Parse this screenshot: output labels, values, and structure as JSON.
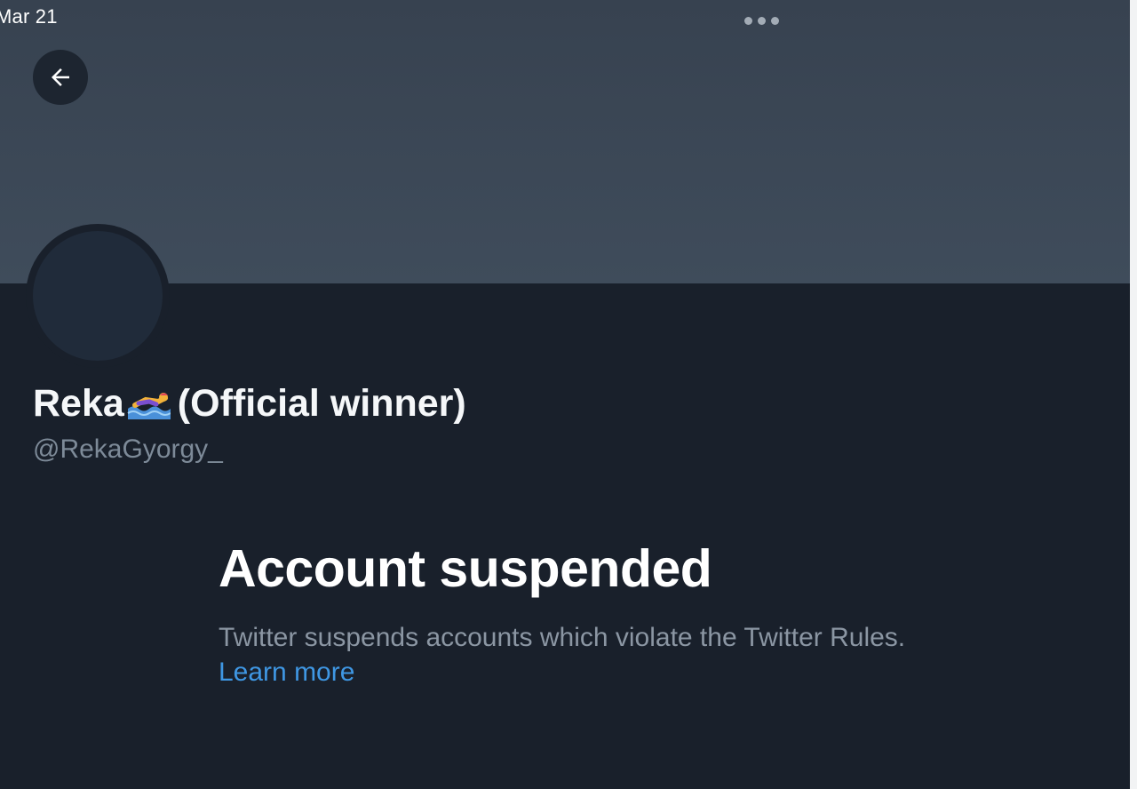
{
  "status_bar": {
    "date": "Mar 21"
  },
  "header": {
    "back_icon": "arrow-left-icon",
    "more_icon": "more-dots-icon"
  },
  "profile": {
    "name_before": "Reka",
    "name_emoji": "swimmer-emoji",
    "name_after": "(Official winner)",
    "handle": "@RekaGyorgy_"
  },
  "suspension": {
    "title": "Account suspended",
    "description": "Twitter suspends accounts which violate the Twitter Rules.",
    "learn_more": "Learn more"
  },
  "colors": {
    "background": "#19202b",
    "banner": "#3c4856",
    "link": "#3f97e3",
    "muted_text": "#8b96a3"
  }
}
